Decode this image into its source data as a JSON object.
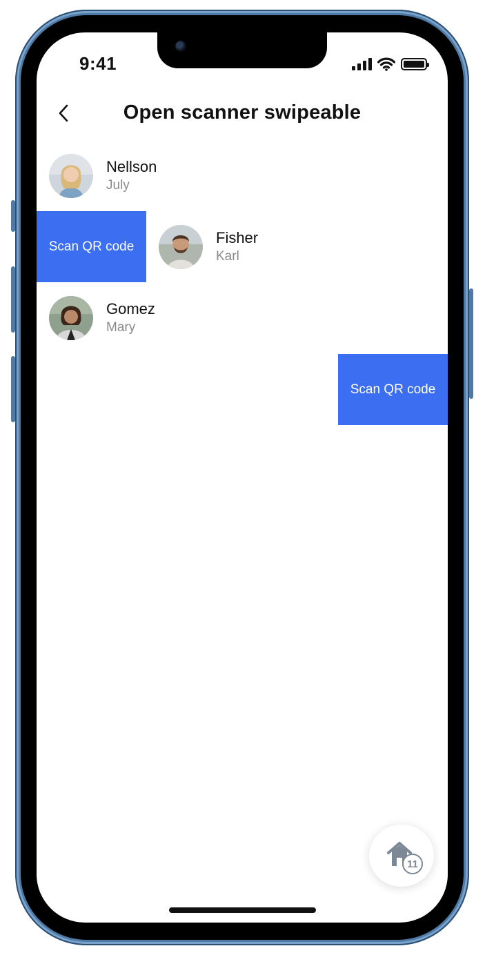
{
  "status_bar": {
    "time": "9:41"
  },
  "header": {
    "title": "Open scanner swipeable"
  },
  "icons": {
    "back": "chevron-left-icon",
    "home": "home-icon",
    "signal": "cellular-signal-icon",
    "wifi": "wifi-icon",
    "battery": "battery-icon"
  },
  "list": {
    "items": [
      {
        "primary": "Nellson",
        "secondary": "July",
        "avatar": "avatar-nellson"
      },
      {
        "primary": "Fisher",
        "secondary": "Karl",
        "avatar": "avatar-fisher",
        "action_label": "Scan QR code"
      },
      {
        "primary": "Gomez",
        "secondary": "Mary",
        "avatar": "avatar-gomez"
      }
    ],
    "trailing_action_label": "Scan QR code"
  },
  "fab": {
    "badge": "11"
  },
  "colors": {
    "accent": "#3b6ef0",
    "text_primary": "#111111",
    "text_secondary": "#8a8a8a"
  }
}
